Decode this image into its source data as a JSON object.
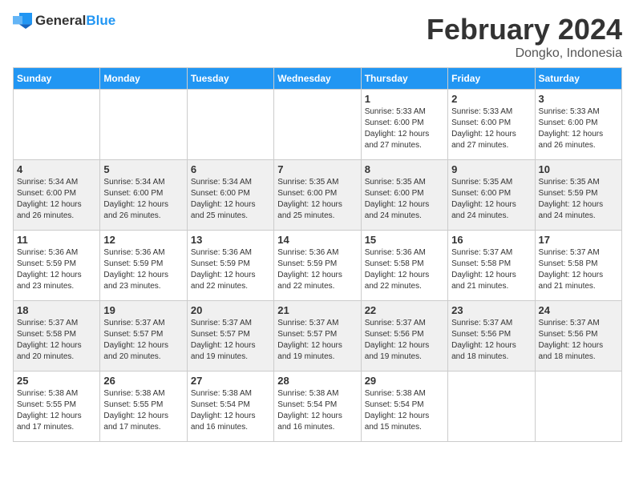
{
  "header": {
    "logo_general": "General",
    "logo_blue": "Blue",
    "title": "February 2024",
    "subtitle": "Dongko, Indonesia"
  },
  "columns": [
    "Sunday",
    "Monday",
    "Tuesday",
    "Wednesday",
    "Thursday",
    "Friday",
    "Saturday"
  ],
  "weeks": [
    [
      {
        "day": "",
        "info": ""
      },
      {
        "day": "",
        "info": ""
      },
      {
        "day": "",
        "info": ""
      },
      {
        "day": "",
        "info": ""
      },
      {
        "day": "1",
        "info": "Sunrise: 5:33 AM\nSunset: 6:00 PM\nDaylight: 12 hours\nand 27 minutes."
      },
      {
        "day": "2",
        "info": "Sunrise: 5:33 AM\nSunset: 6:00 PM\nDaylight: 12 hours\nand 27 minutes."
      },
      {
        "day": "3",
        "info": "Sunrise: 5:33 AM\nSunset: 6:00 PM\nDaylight: 12 hours\nand 26 minutes."
      }
    ],
    [
      {
        "day": "4",
        "info": "Sunrise: 5:34 AM\nSunset: 6:00 PM\nDaylight: 12 hours\nand 26 minutes."
      },
      {
        "day": "5",
        "info": "Sunrise: 5:34 AM\nSunset: 6:00 PM\nDaylight: 12 hours\nand 26 minutes."
      },
      {
        "day": "6",
        "info": "Sunrise: 5:34 AM\nSunset: 6:00 PM\nDaylight: 12 hours\nand 25 minutes."
      },
      {
        "day": "7",
        "info": "Sunrise: 5:35 AM\nSunset: 6:00 PM\nDaylight: 12 hours\nand 25 minutes."
      },
      {
        "day": "8",
        "info": "Sunrise: 5:35 AM\nSunset: 6:00 PM\nDaylight: 12 hours\nand 24 minutes."
      },
      {
        "day": "9",
        "info": "Sunrise: 5:35 AM\nSunset: 6:00 PM\nDaylight: 12 hours\nand 24 minutes."
      },
      {
        "day": "10",
        "info": "Sunrise: 5:35 AM\nSunset: 5:59 PM\nDaylight: 12 hours\nand 24 minutes."
      }
    ],
    [
      {
        "day": "11",
        "info": "Sunrise: 5:36 AM\nSunset: 5:59 PM\nDaylight: 12 hours\nand 23 minutes."
      },
      {
        "day": "12",
        "info": "Sunrise: 5:36 AM\nSunset: 5:59 PM\nDaylight: 12 hours\nand 23 minutes."
      },
      {
        "day": "13",
        "info": "Sunrise: 5:36 AM\nSunset: 5:59 PM\nDaylight: 12 hours\nand 22 minutes."
      },
      {
        "day": "14",
        "info": "Sunrise: 5:36 AM\nSunset: 5:59 PM\nDaylight: 12 hours\nand 22 minutes."
      },
      {
        "day": "15",
        "info": "Sunrise: 5:36 AM\nSunset: 5:58 PM\nDaylight: 12 hours\nand 22 minutes."
      },
      {
        "day": "16",
        "info": "Sunrise: 5:37 AM\nSunset: 5:58 PM\nDaylight: 12 hours\nand 21 minutes."
      },
      {
        "day": "17",
        "info": "Sunrise: 5:37 AM\nSunset: 5:58 PM\nDaylight: 12 hours\nand 21 minutes."
      }
    ],
    [
      {
        "day": "18",
        "info": "Sunrise: 5:37 AM\nSunset: 5:58 PM\nDaylight: 12 hours\nand 20 minutes."
      },
      {
        "day": "19",
        "info": "Sunrise: 5:37 AM\nSunset: 5:57 PM\nDaylight: 12 hours\nand 20 minutes."
      },
      {
        "day": "20",
        "info": "Sunrise: 5:37 AM\nSunset: 5:57 PM\nDaylight: 12 hours\nand 19 minutes."
      },
      {
        "day": "21",
        "info": "Sunrise: 5:37 AM\nSunset: 5:57 PM\nDaylight: 12 hours\nand 19 minutes."
      },
      {
        "day": "22",
        "info": "Sunrise: 5:37 AM\nSunset: 5:56 PM\nDaylight: 12 hours\nand 19 minutes."
      },
      {
        "day": "23",
        "info": "Sunrise: 5:37 AM\nSunset: 5:56 PM\nDaylight: 12 hours\nand 18 minutes."
      },
      {
        "day": "24",
        "info": "Sunrise: 5:37 AM\nSunset: 5:56 PM\nDaylight: 12 hours\nand 18 minutes."
      }
    ],
    [
      {
        "day": "25",
        "info": "Sunrise: 5:38 AM\nSunset: 5:55 PM\nDaylight: 12 hours\nand 17 minutes."
      },
      {
        "day": "26",
        "info": "Sunrise: 5:38 AM\nSunset: 5:55 PM\nDaylight: 12 hours\nand 17 minutes."
      },
      {
        "day": "27",
        "info": "Sunrise: 5:38 AM\nSunset: 5:54 PM\nDaylight: 12 hours\nand 16 minutes."
      },
      {
        "day": "28",
        "info": "Sunrise: 5:38 AM\nSunset: 5:54 PM\nDaylight: 12 hours\nand 16 minutes."
      },
      {
        "day": "29",
        "info": "Sunrise: 5:38 AM\nSunset: 5:54 PM\nDaylight: 12 hours\nand 15 minutes."
      },
      {
        "day": "",
        "info": ""
      },
      {
        "day": "",
        "info": ""
      }
    ]
  ]
}
